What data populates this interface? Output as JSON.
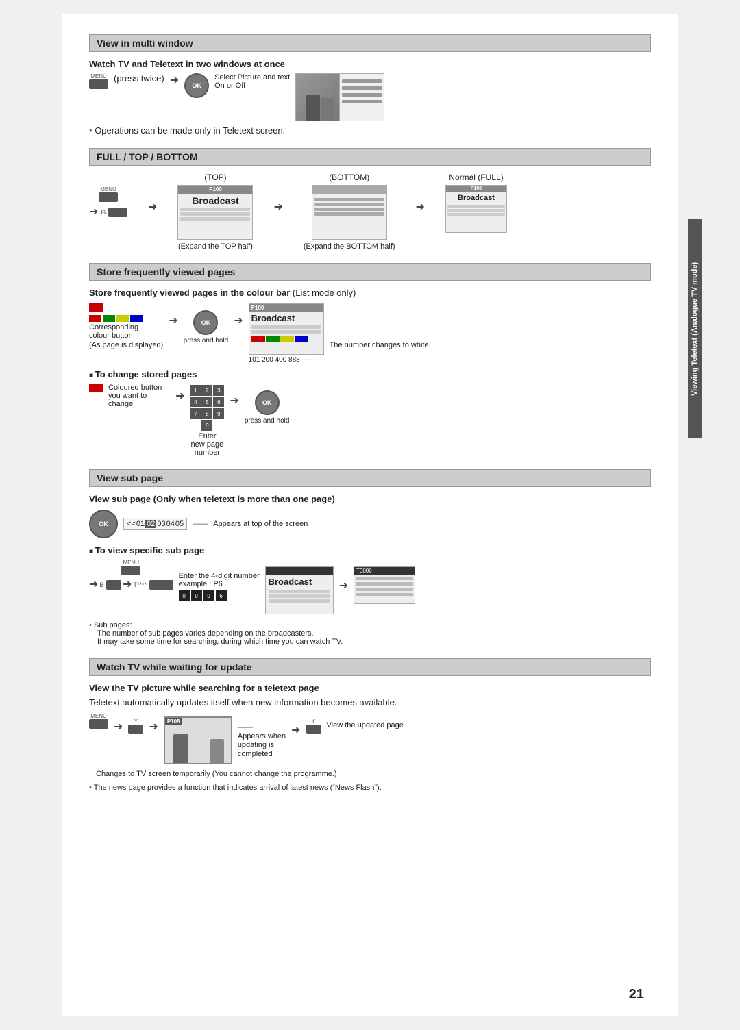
{
  "page": {
    "number": "21",
    "side_label": "Viewing Teletext (Analogue TV mode)"
  },
  "sections": {
    "view_multi": {
      "title": "View in multi window",
      "subtitle": "Watch TV and Teletext in two windows at once",
      "menu_label": "MENU",
      "press_twice": "(press twice)",
      "select_text": "Select Picture and text",
      "on_off": "On or Off",
      "note": "Operations can be made only in Teletext screen."
    },
    "full_top_bottom": {
      "title": "FULL / TOP / BOTTOM",
      "top_label": "(TOP)",
      "bottom_label": "(BOTTOM)",
      "normal_full": "Normal (FULL)",
      "p100": "P100",
      "broadcast": "Broadcast",
      "expand_top": "(Expand the TOP half)",
      "expand_bottom": "(Expand the BOTTOM half)"
    },
    "store_pages": {
      "title": "Store frequently viewed pages",
      "subtitle_bold": "Store frequently viewed pages in the colour bar",
      "subtitle_rest": " (List mode only)",
      "colour_button": "Corresponding colour button",
      "as_page": "(As page is displayed)",
      "press_hold": "press and hold",
      "number_changes": "The number changes to white.",
      "p100": "P100",
      "broadcast": "Broadcast",
      "nums": "101   200   400   888",
      "change_title": "To change stored pages",
      "coloured_btn": "Coloured button",
      "you_want": "you want to change",
      "enter": "Enter",
      "new_page": "new page",
      "number": "number",
      "press_hold2": "press and hold"
    },
    "view_sub": {
      "title": "View sub page",
      "subtitle": "View sub page (Only when teletext is more than one page)",
      "sub_bar": "<<01 02 03 04 05",
      "appears_top": "Appears at top of the screen",
      "specific_title": "To view specific sub page",
      "menu_label": "MENU",
      "b_label": "B",
      "t_label": "T****",
      "enter_4digit": "Enter the 4-digit number",
      "example": "example : P6",
      "digits": "0  0  0  6",
      "broadcast": "Broadcast",
      "t0006": "T0006",
      "sub_pages_note1": "Sub pages:",
      "sub_pages_note2": "The number of sub pages varies depending on the broadcasters.",
      "sub_pages_note3": "It may take some time for searching, during which time you can watch TV."
    },
    "watch_tv": {
      "title": "Watch TV while waiting for update",
      "subtitle": "View the TV picture while searching for a teletext page",
      "description": "Teletext automatically updates itself when new information becomes available.",
      "menu_label": "MENU",
      "y_label": "Y",
      "p108_label": "P108",
      "appears_when": "Appears when",
      "updating_is": "updating is",
      "completed": "completed",
      "y_label2": "Y",
      "view_updated": "View the updated page",
      "changes_note": "Changes to TV screen temporarily (You cannot change the programme.)",
      "news_note": "The news page provides a function that indicates arrival of latest news (“News Flash”)."
    }
  }
}
